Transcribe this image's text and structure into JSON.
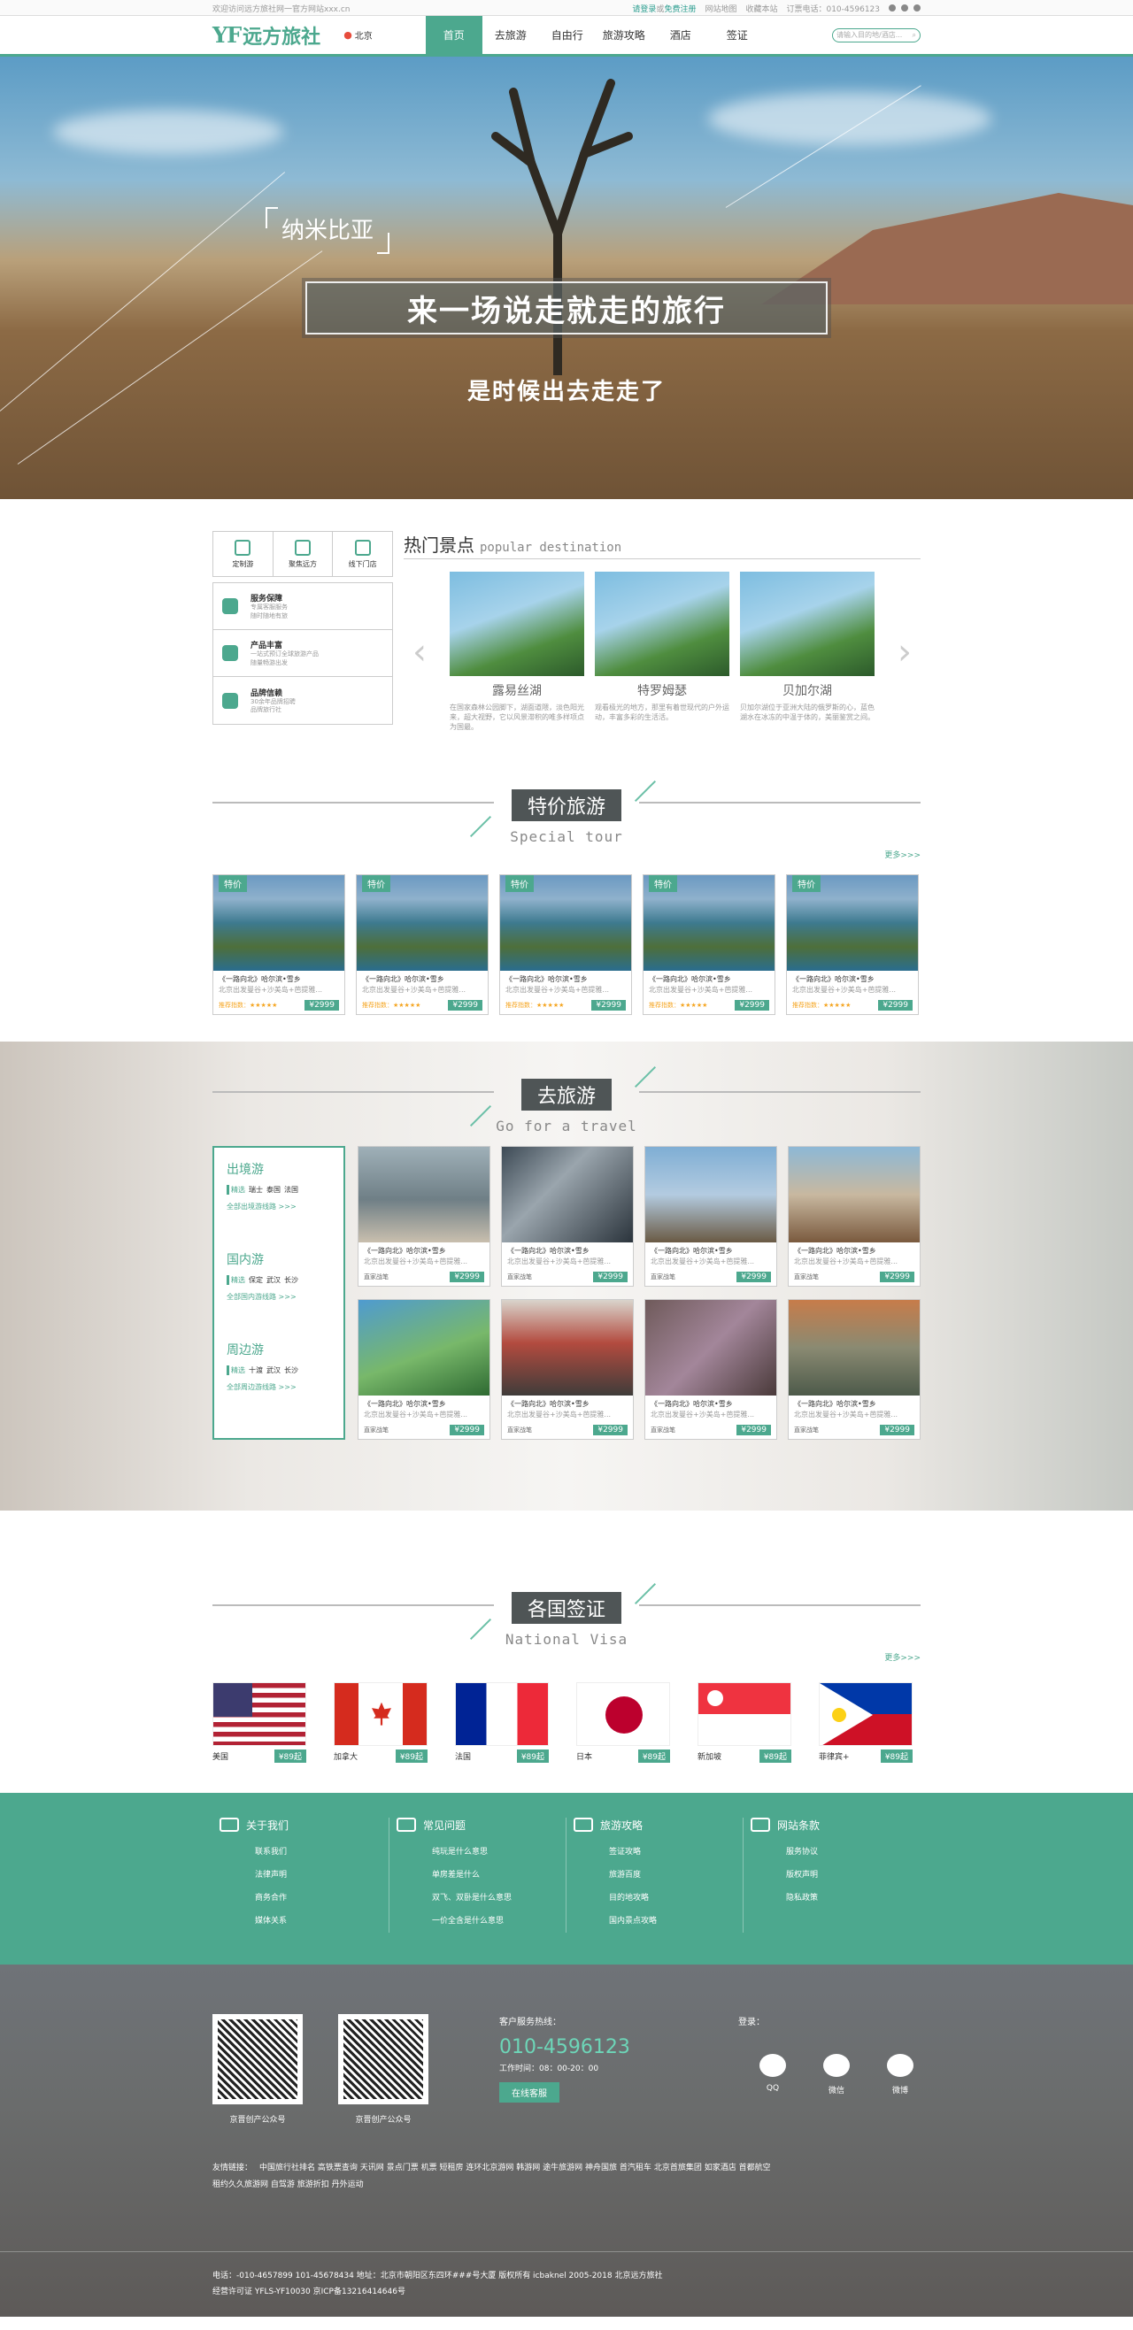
{
  "topbar": {
    "welcome": "欢迎访问远方旅社网一官方网站xxx.cn",
    "login": "请登录",
    "or": "或",
    "register": "免费注册",
    "sitemap": "网站地图",
    "collect": "收藏本站",
    "phone": "订票电话：010-4596123"
  },
  "header": {
    "logo_yf": "YF",
    "logo_text": "远方旅社",
    "location": "北京",
    "nav": [
      "首页",
      "去旅游",
      "自由行",
      "旅游攻略",
      "酒店",
      "签证"
    ],
    "search_placeholder": "请输入目的地/酒店..."
  },
  "hero": {
    "tag": "纳米比亚",
    "title": "来一场说走就走的旅行",
    "subtitle": "是时候出去走走了"
  },
  "services": {
    "top": [
      "定制游",
      "聚焦远方",
      "线下门店"
    ],
    "list": [
      {
        "title": "服务保障",
        "desc1": "专属客服服务",
        "desc2": "随时随地有旅"
      },
      {
        "title": "产品丰富",
        "desc1": "一站式预订全球旅游产品",
        "desc2": "随量畅游出发"
      },
      {
        "title": "品牌信赖",
        "desc1": "30余年品牌招聘",
        "desc2": "品牌旅行社"
      }
    ]
  },
  "popular": {
    "title_cn": "热门景点",
    "title_en": "popular destination",
    "items": [
      {
        "name": "露易丝湖",
        "desc": "在国家森林公园脚下，湖面道隈，淡色阳光来，超大视野，它以风景滞积的唯多样项点为国最。"
      },
      {
        "name": "特罗姆瑟",
        "desc": "观看极光的地方，那里有着世现代的户外运动，丰富多彩的生活活。"
      },
      {
        "name": "贝加尔湖",
        "desc": "贝加尔湖位于亚洲大陆的俄罗斯的心，蓝色湖水在冰冻的中温于体的，美丽鉴赏之间。"
      }
    ]
  },
  "special": {
    "title_cn": "特价旅游",
    "title_en": "Special tour",
    "more": "更多>>>",
    "badge": "特价",
    "cards": [
      {
        "title": "《一路向北》哈尔滨•雪乡",
        "sub": "北京出发曼谷+沙美岛+芭提雅...",
        "rating": "推荐指数：★★★★★",
        "price": "¥2999"
      },
      {
        "title": "《一路向北》哈尔滨•雪乡",
        "sub": "北京出发曼谷+沙美岛+芭提雅...",
        "rating": "推荐指数：★★★★★",
        "price": "¥2999"
      },
      {
        "title": "《一路向北》哈尔滨•雪乡",
        "sub": "北京出发曼谷+沙美岛+芭提雅...",
        "rating": "推荐指数：★★★★★",
        "price": "¥2999"
      },
      {
        "title": "《一路向北》哈尔滨•雪乡",
        "sub": "北京出发曼谷+沙美岛+芭提雅...",
        "rating": "推荐指数：★★★★★",
        "price": "¥2999"
      },
      {
        "title": "《一路向北》哈尔滨•雪乡",
        "sub": "北京出发曼谷+沙美岛+芭提雅...",
        "rating": "推荐指数：★★★★★",
        "price": "¥2999"
      }
    ]
  },
  "travel": {
    "title_cn": "去旅游",
    "title_en": "Go for a travel",
    "regions": [
      {
        "title": "出境游",
        "tag": "精选",
        "places": [
          "瑞士",
          "泰国",
          "法国"
        ],
        "link": "全部出境游线路 >>>"
      },
      {
        "title": "国内游",
        "tag": "精选",
        "places": [
          "保定",
          "武汉",
          "长沙"
        ],
        "link": "全部国内游线路 >>>"
      },
      {
        "title": "周边游",
        "tag": "精选",
        "places": [
          "十渡",
          "武汉",
          "长沙"
        ],
        "link": "全部周边游线路 >>>"
      }
    ],
    "cards": [
      {
        "title": "《一路向北》哈尔滨•雪乡",
        "sub": "北京出发曼谷+沙美岛+芭提雅...",
        "note": "直家战笔",
        "price": "¥2999"
      },
      {
        "title": "《一路向北》哈尔滨•雪乡",
        "sub": "北京出发曼谷+沙美岛+芭提雅...",
        "note": "直家战笔",
        "price": "¥2999"
      },
      {
        "title": "《一路向北》哈尔滨•雪乡",
        "sub": "北京出发曼谷+沙美岛+芭提雅...",
        "note": "直家战笔",
        "price": "¥2999"
      },
      {
        "title": "《一路向北》哈尔滨•雪乡",
        "sub": "北京出发曼谷+沙美岛+芭提雅...",
        "note": "直家战笔",
        "price": "¥2999"
      },
      {
        "title": "《一路向北》哈尔滨•雪乡",
        "sub": "北京出发曼谷+沙美岛+芭提雅...",
        "note": "直家战笔",
        "price": "¥2999"
      },
      {
        "title": "《一路向北》哈尔滨•雪乡",
        "sub": "北京出发曼谷+沙美岛+芭提雅...",
        "note": "直家战笔",
        "price": "¥2999"
      },
      {
        "title": "《一路向北》哈尔滨•雪乡",
        "sub": "北京出发曼谷+沙美岛+芭提雅...",
        "note": "直家战笔",
        "price": "¥2999"
      },
      {
        "title": "《一路向北》哈尔滨•雪乡",
        "sub": "北京出发曼谷+沙美岛+芭提雅...",
        "note": "直家战笔",
        "price": "¥2999"
      }
    ]
  },
  "visa": {
    "title_cn": "各国签证",
    "title_en": "National Visa",
    "more": "更多>>>",
    "items": [
      {
        "country": "美国",
        "price": "¥89起"
      },
      {
        "country": "加拿大",
        "price": "¥89起"
      },
      {
        "country": "法国",
        "price": "¥89起"
      },
      {
        "country": "日本",
        "price": "¥89起"
      },
      {
        "country": "新加坡",
        "price": "¥89起"
      },
      {
        "country": "菲律宾+",
        "price": "¥89起"
      }
    ]
  },
  "footer": {
    "cols": [
      {
        "title": "关于我们",
        "items": [
          "联系我们",
          "法律声明",
          "商务合作",
          "媒体关系"
        ]
      },
      {
        "title": "常见问题",
        "items": [
          "纯玩是什么意思",
          "单房差是什么",
          "双飞、双卧是什么意思",
          "一价全含是什么意思"
        ]
      },
      {
        "title": "旅游攻略",
        "items": [
          "签证攻略",
          "旅游百度",
          "目的地攻略",
          "国内景点攻略"
        ]
      },
      {
        "title": "网站条款",
        "items": [
          "服务协议",
          "版权声明",
          "隐私政策"
        ]
      }
    ],
    "qr1": "京晋创产公众号",
    "qr2": "京晋创产公众号",
    "hotline_label": "客户服务热线：",
    "hotline": "010-4596123",
    "work_time": "工作时间：08：00-20：00",
    "online_btn": "在线客服",
    "login_label": "登录：",
    "socials": [
      "QQ",
      "微信",
      "微博"
    ],
    "links_label": "友情链接：",
    "links": [
      "中国旅行社排名",
      "高铁票查询",
      "天讯网",
      "景点门票",
      "机票",
      "短租房",
      "连环北京游网",
      "韩游网",
      "途牛旅游网",
      "神舟国旅",
      "首汽租车",
      "北京首旅集团",
      "如家酒店",
      "首都航空",
      "租约久久旅游网",
      "自驾游",
      "旅游折扣",
      "丹外运动"
    ],
    "copyright1": "电话：-010-4657899 101-45678434  地址：北京市朝阳区东四环###号大厦 版权所有 icbaknel 2005-2018 北京远方旅社",
    "copyright2": "经营许可证 YFLS-YF10030  京ICP备13216414646号"
  },
  "colors": {
    "accent": "#4ca88e",
    "dark_box": "#4f5556"
  }
}
